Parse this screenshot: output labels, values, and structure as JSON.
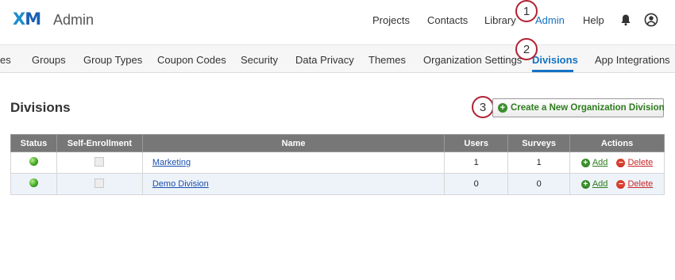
{
  "header": {
    "logo": "XM",
    "logo_x": "X",
    "logo_m": "M",
    "app_title": "Admin",
    "nav": [
      "Projects",
      "Contacts",
      "Library",
      "Admin",
      "Help"
    ],
    "icons": [
      "bell-icon",
      "user-icon"
    ]
  },
  "subnav": {
    "tabs": [
      "es",
      "Groups",
      "Group Types",
      "Coupon Codes",
      "Security",
      "Data Privacy",
      "Themes",
      "Organization Settings",
      "Divisions",
      "App Integrations"
    ],
    "active": "Divisions"
  },
  "markers": [
    "1",
    "2",
    "3"
  ],
  "page": {
    "title": "Divisions",
    "create_button": "Create a New Organization Division"
  },
  "table": {
    "columns": [
      "Status",
      "Self-Enrollment",
      "Name",
      "Users",
      "Surveys",
      "Actions"
    ],
    "rows": [
      {
        "name": "Marketing",
        "users": "1",
        "surveys": "1",
        "add": "Add",
        "delete": "Delete"
      },
      {
        "name": "Demo Division",
        "users": "0",
        "surveys": "0",
        "add": "Add",
        "delete": "Delete"
      }
    ]
  },
  "colors": {
    "accent": "#1572c4",
    "marker": "#b22234",
    "header_bg": "#777777",
    "add": "#2e7d1e",
    "delete": "#c62828",
    "status": "#3aa01e"
  }
}
